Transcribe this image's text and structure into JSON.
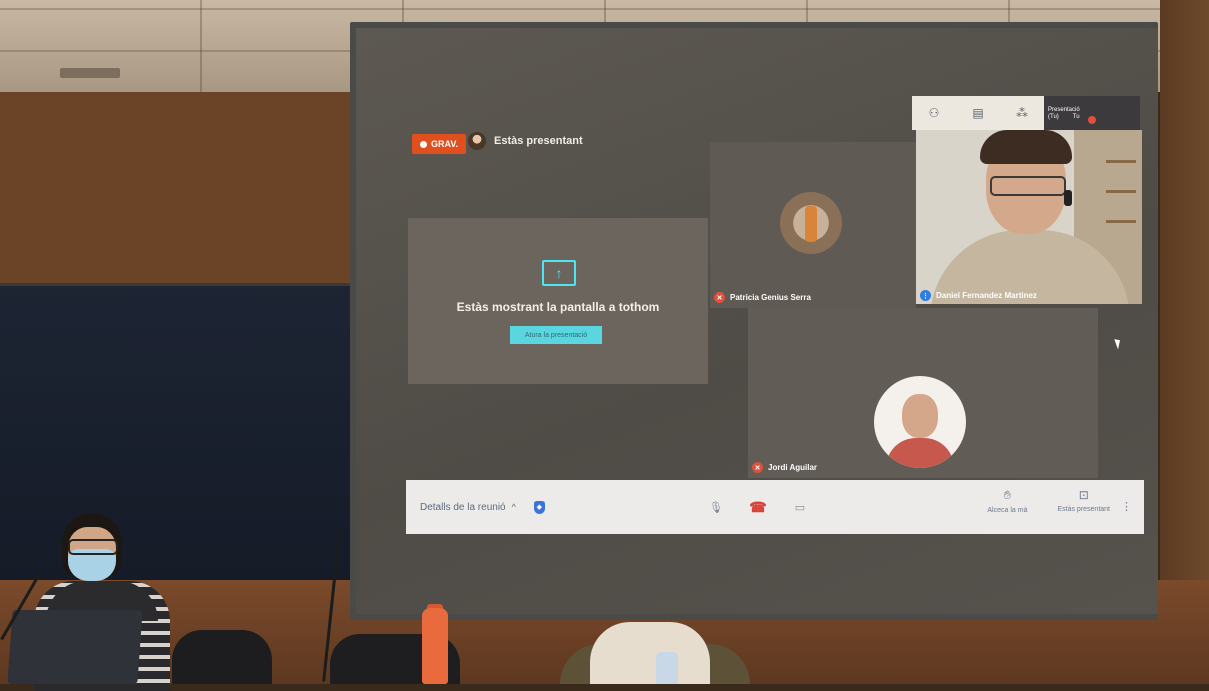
{
  "meeting": {
    "recording_badge": "GRAV.",
    "presenting_status": "Estàs presentant"
  },
  "presentation_tile": {
    "message": "Estàs mostrant la pantalla a tothom",
    "stop_button": "Atura la presentació"
  },
  "participants": [
    {
      "name": "Patricia Genius Serra",
      "mic": "muted"
    },
    {
      "name": "Daniel Fernandez Martinez",
      "mic": "speaking"
    },
    {
      "name": "Jordi Aguilar",
      "mic": "muted"
    }
  ],
  "top_toolbar": {
    "icons": [
      "people-icon",
      "chat-icon",
      "activities-icon"
    ],
    "self_tile_label": "Presentació",
    "self_tile_sub1": "(Tu)",
    "self_tile_sub2": "Tu"
  },
  "bottom_bar": {
    "details_label": "Detalls de la reunió",
    "raise_hand_label": "Alceca la mà",
    "present_label": "Estàs presentant"
  },
  "colors": {
    "recording": "#e0501f",
    "accent": "#4de6f0",
    "hangup": "#d9443a",
    "muted": "#e0503a"
  }
}
